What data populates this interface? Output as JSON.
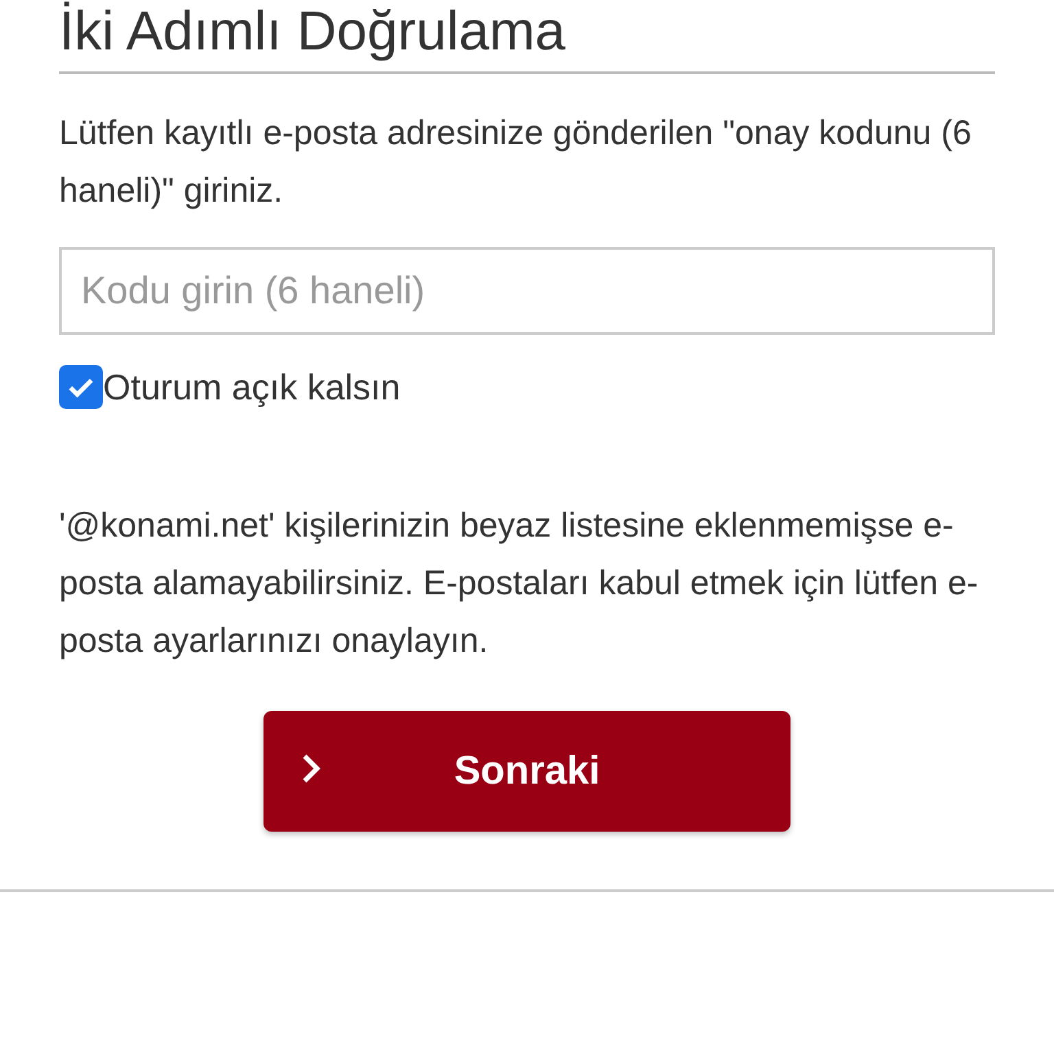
{
  "title": "İki Adımlı Doğrulama",
  "instruction": "Lütfen kayıtlı e-posta adresinize gönderilen \"onay kodunu (6 haneli)\" giriniz.",
  "code_field": {
    "placeholder": "Kodu girin (6 haneli)"
  },
  "keep_signed_in": {
    "label": "Oturum açık kalsın",
    "checked": true
  },
  "notice": "'@konami.net' kişilerinizin beyaz listesine eklenmemişse e-posta alamayabilirsiniz. E-postaları kabul etmek için lütfen e-posta ayarlarınızı onaylayın.",
  "next_button": {
    "label": "Sonraki"
  }
}
